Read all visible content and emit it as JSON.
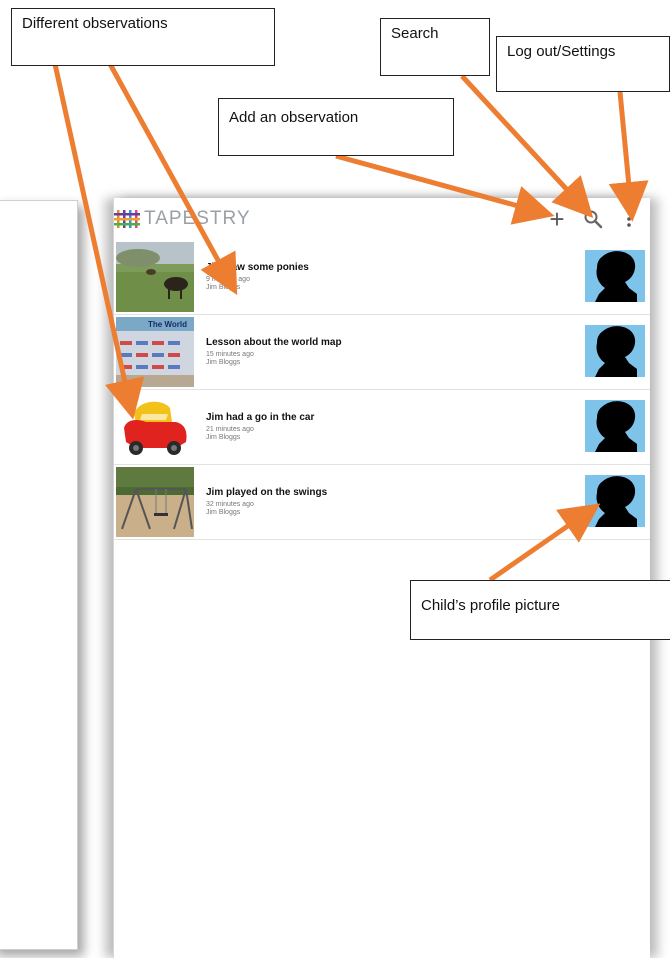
{
  "app": {
    "title": "TAPESTRY",
    "logo_icon": "tapestry-logo-icon",
    "actions": [
      {
        "name": "add-observation-button",
        "icon": "plus-icon",
        "glyph": "+"
      },
      {
        "name": "search-button",
        "icon": "search-icon"
      },
      {
        "name": "overflow-menu-button",
        "icon": "more-vert-icon"
      }
    ]
  },
  "observations": [
    {
      "title": "Jim saw some ponies",
      "time": "9 minutes ago",
      "author": "Jim Bloggs",
      "thumb": "ponies-photo"
    },
    {
      "title": "Lesson about the world map",
      "time": "15 minutes ago",
      "author": "Jim Bloggs",
      "thumb": "world-map-photo",
      "thumb_text": "The World"
    },
    {
      "title": "Jim had a go in the car",
      "time": "21 minutes ago",
      "author": "Jim Bloggs",
      "thumb": "toy-car-photo"
    },
    {
      "title": "Jim played on the swings",
      "time": "32 minutes ago",
      "author": "Jim Bloggs",
      "thumb": "swings-photo"
    }
  ],
  "annotations": {
    "different_observations": "Different observations",
    "search": "Search",
    "logout_settings": "Log out/Settings",
    "add_observation": "Add an observation",
    "child_profile": "Child’s profile picture"
  },
  "colors": {
    "arrow": "#ed7d31",
    "title_text": "#9aa0a6",
    "logo_purple": "#6a3d9a",
    "logo_orange": "#f0a030"
  }
}
